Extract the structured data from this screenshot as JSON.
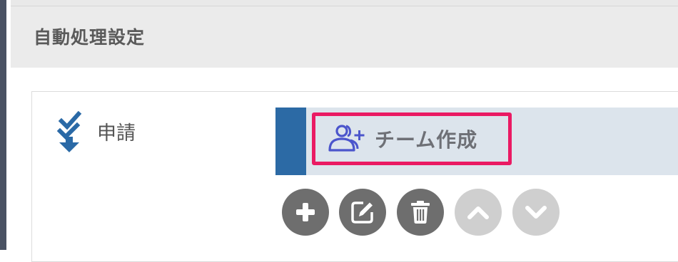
{
  "section": {
    "title": "自動処理設定"
  },
  "step": {
    "label": "申請",
    "icon": "check-down-arrow-icon"
  },
  "process": {
    "label": "チーム作成",
    "icon": "user-plus-icon",
    "accent_color": "#2c6aa5",
    "highlight_color": "#ea1a63"
  },
  "actions": [
    {
      "name": "add-button",
      "icon": "plus-icon",
      "enabled": true
    },
    {
      "name": "edit-button",
      "icon": "edit-icon",
      "enabled": true
    },
    {
      "name": "delete-button",
      "icon": "trash-icon",
      "enabled": true
    },
    {
      "name": "move-up-button",
      "icon": "chevron-up-icon",
      "enabled": false
    },
    {
      "name": "move-down-button",
      "icon": "chevron-down-icon",
      "enabled": false
    }
  ]
}
